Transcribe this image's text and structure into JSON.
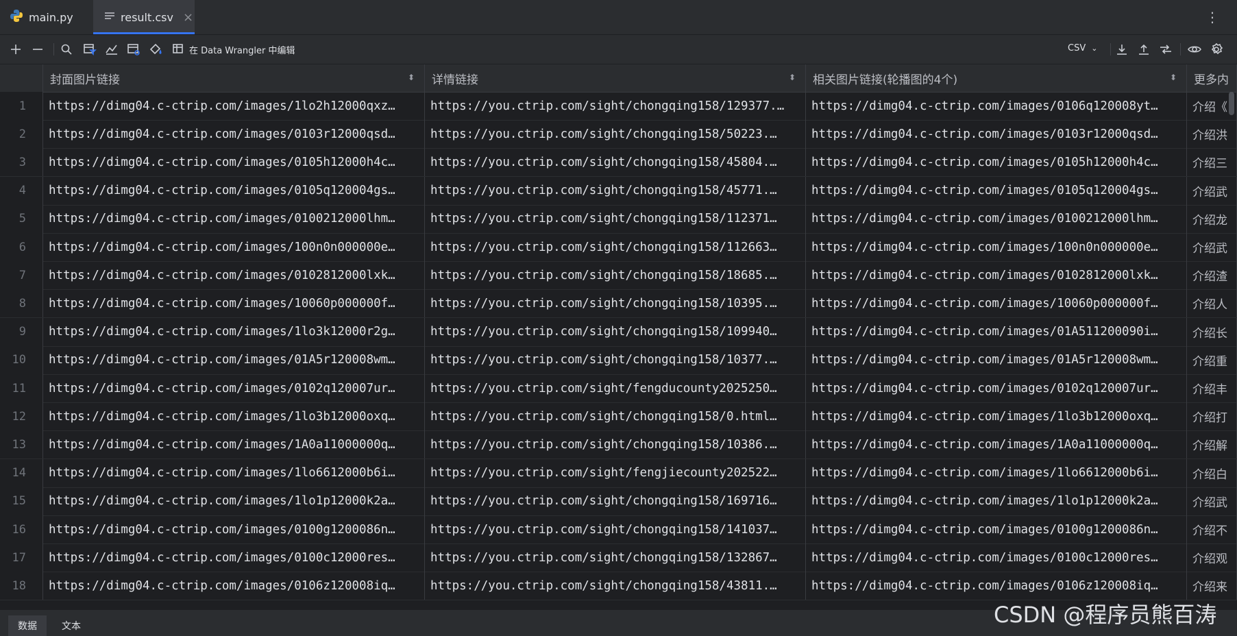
{
  "tabs": [
    {
      "label": "main.py",
      "icon": "python-icon",
      "active": false
    },
    {
      "label": "result.csv",
      "icon": "csv-file-icon",
      "active": true,
      "close": "×"
    }
  ],
  "toolbar": {
    "data_wrangler_label": "在 Data Wrangler 中编辑",
    "format": "CSV"
  },
  "table": {
    "columns": [
      "封面图片链接",
      "详情链接",
      "相关图片链接(轮播图的4个)",
      "更多内"
    ],
    "rows": [
      [
        "1",
        "https://dimg04.c-ctrip.com/images/1lo2h12000qxz…",
        "https://you.ctrip.com/sight/chongqing158/129377.…",
        "https://dimg04.c-ctrip.com/images/0106q120008yt…",
        "介绍《"
      ],
      [
        "2",
        "https://dimg04.c-ctrip.com/images/0103r12000qsd…",
        "https://you.ctrip.com/sight/chongqing158/50223.…",
        "https://dimg04.c-ctrip.com/images/0103r12000qsd…",
        "介绍洪"
      ],
      [
        "3",
        "https://dimg04.c-ctrip.com/images/0105h12000h4c…",
        "https://you.ctrip.com/sight/chongqing158/45804.…",
        "https://dimg04.c-ctrip.com/images/0105h12000h4c…",
        "介绍三"
      ],
      [
        "4",
        "https://dimg04.c-ctrip.com/images/0105q120004gs…",
        "https://you.ctrip.com/sight/chongqing158/45771.…",
        "https://dimg04.c-ctrip.com/images/0105q120004gs…",
        "介绍武"
      ],
      [
        "5",
        "https://dimg04.c-ctrip.com/images/0100212000lhm…",
        "https://you.ctrip.com/sight/chongqing158/112371…",
        "https://dimg04.c-ctrip.com/images/0100212000lhm…",
        "介绍龙"
      ],
      [
        "6",
        "https://dimg04.c-ctrip.com/images/100n0n000000e…",
        "https://you.ctrip.com/sight/chongqing158/112663…",
        "https://dimg04.c-ctrip.com/images/100n0n000000e…",
        "介绍武"
      ],
      [
        "7",
        "https://dimg04.c-ctrip.com/images/0102812000lxk…",
        "https://you.ctrip.com/sight/chongqing158/18685.…",
        "https://dimg04.c-ctrip.com/images/0102812000lxk…",
        "介绍渣"
      ],
      [
        "8",
        "https://dimg04.c-ctrip.com/images/10060p000000f…",
        "https://you.ctrip.com/sight/chongqing158/10395.…",
        "https://dimg04.c-ctrip.com/images/10060p000000f…",
        "介绍人"
      ],
      [
        "9",
        "https://dimg04.c-ctrip.com/images/1lo3k12000r2g…",
        "https://you.ctrip.com/sight/chongqing158/109940…",
        "https://dimg04.c-ctrip.com/images/01A511200090i…",
        "介绍长"
      ],
      [
        "10",
        "https://dimg04.c-ctrip.com/images/01A5r120008wm…",
        "https://you.ctrip.com/sight/chongqing158/10377.…",
        "https://dimg04.c-ctrip.com/images/01A5r120008wm…",
        "介绍重"
      ],
      [
        "11",
        "https://dimg04.c-ctrip.com/images/0102q120007ur…",
        "https://you.ctrip.com/sight/fengducounty2025250…",
        "https://dimg04.c-ctrip.com/images/0102q120007ur…",
        "介绍丰"
      ],
      [
        "12",
        "https://dimg04.c-ctrip.com/images/1lo3b12000oxq…",
        "https://you.ctrip.com/sight/chongqing158/0.html…",
        "https://dimg04.c-ctrip.com/images/1lo3b12000oxq…",
        "介绍打"
      ],
      [
        "13",
        "https://dimg04.c-ctrip.com/images/1A0a11000000q…",
        "https://you.ctrip.com/sight/chongqing158/10386.…",
        "https://dimg04.c-ctrip.com/images/1A0a11000000q…",
        "介绍解"
      ],
      [
        "14",
        "https://dimg04.c-ctrip.com/images/1lo6612000b6i…",
        "https://you.ctrip.com/sight/fengjiecounty202522…",
        "https://dimg04.c-ctrip.com/images/1lo6612000b6i…",
        "介绍白"
      ],
      [
        "15",
        "https://dimg04.c-ctrip.com/images/1lo1p12000k2a…",
        "https://you.ctrip.com/sight/chongqing158/169716…",
        "https://dimg04.c-ctrip.com/images/1lo1p12000k2a…",
        "介绍武"
      ],
      [
        "16",
        "https://dimg04.c-ctrip.com/images/0100g1200086n…",
        "https://you.ctrip.com/sight/chongqing158/141037…",
        "https://dimg04.c-ctrip.com/images/0100g1200086n…",
        "介绍不"
      ],
      [
        "17",
        "https://dimg04.c-ctrip.com/images/0100c12000res…",
        "https://you.ctrip.com/sight/chongqing158/132867…",
        "https://dimg04.c-ctrip.com/images/0100c12000res…",
        "介绍观"
      ],
      [
        "18",
        "https://dimg04.c-ctrip.com/images/0106z120008iq…",
        "https://you.ctrip.com/sight/chongqing158/43811.…",
        "https://dimg04.c-ctrip.com/images/0106z120008iq…",
        "介绍来"
      ]
    ]
  },
  "bottom_tabs": [
    {
      "label": "数据",
      "active": true
    },
    {
      "label": "文本",
      "active": false
    }
  ],
  "watermark": "CSDN @程序员熊百涛",
  "colors": {
    "accent": "#3574f0",
    "background": "#1e1f22",
    "panel": "#2b2d30"
  }
}
